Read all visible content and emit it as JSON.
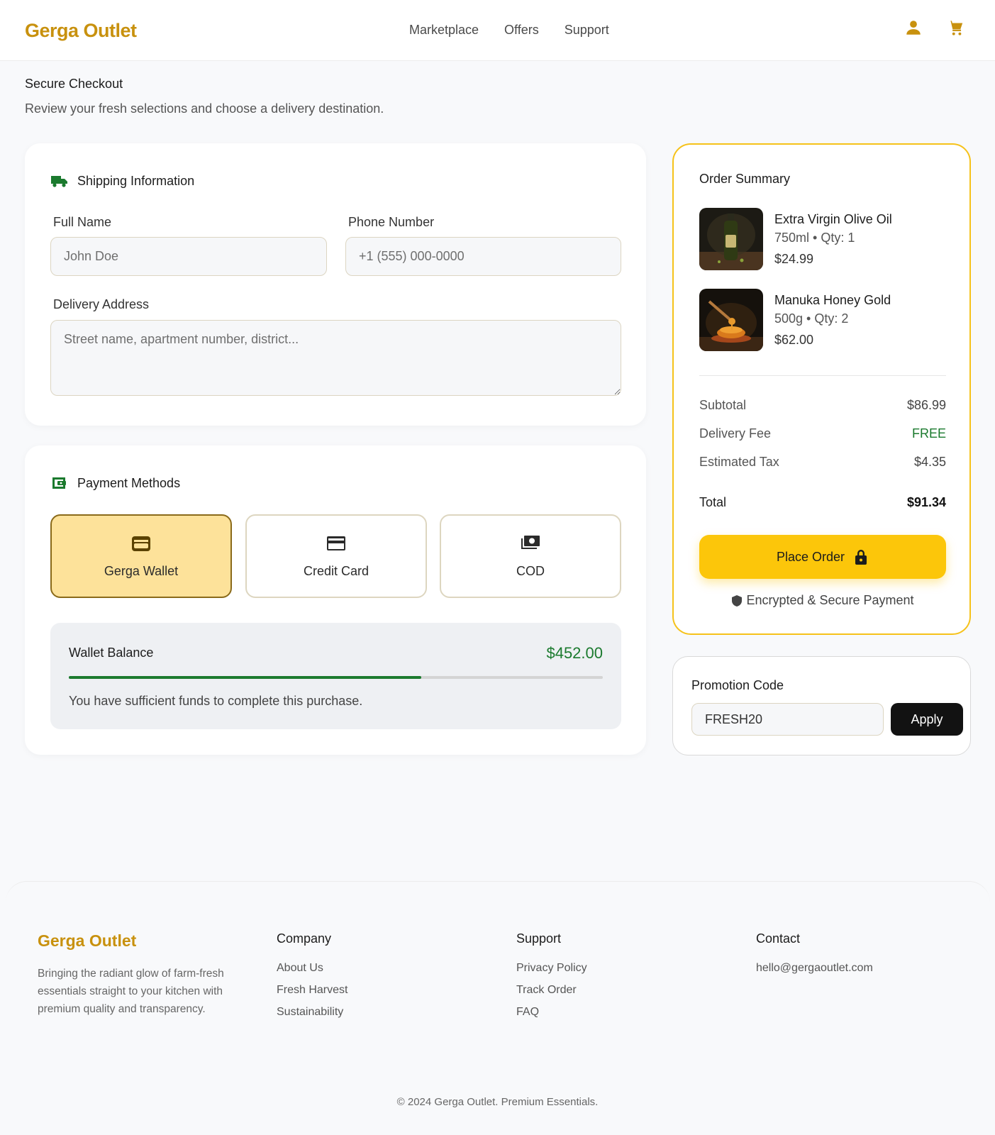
{
  "header": {
    "brand": "Gerga Outlet",
    "nav": [
      "Marketplace",
      "Offers",
      "Support"
    ],
    "icons": [
      "user-icon",
      "cart-icon"
    ],
    "accent_color": "#c8910e"
  },
  "page": {
    "title": "Secure Checkout",
    "subtitle": "Review your fresh selections and choose a delivery destination."
  },
  "shipping": {
    "heading": "Shipping Information",
    "full_name_label": "Full Name",
    "full_name_placeholder": "John Doe",
    "phone_label": "Phone Number",
    "phone_placeholder": "+1 (555) 000-0000",
    "address_label": "Delivery Address",
    "address_placeholder": "Street name, apartment number, district..."
  },
  "payment": {
    "heading": "Payment Methods",
    "options": [
      {
        "label": "Gerga Wallet",
        "icon": "wallet-icon",
        "selected": true
      },
      {
        "label": "Credit Card",
        "icon": "credit-card-icon",
        "selected": false
      },
      {
        "label": "COD",
        "icon": "cash-icon",
        "selected": false
      }
    ],
    "wallet": {
      "title": "Wallet Balance",
      "amount": "$452.00",
      "progress": 0.66,
      "note": "You have sufficient funds to complete this purchase."
    }
  },
  "summary": {
    "title": "Order Summary",
    "items": [
      {
        "name": "Extra Virgin Olive Oil",
        "meta": "750ml • Qty: 1",
        "price": "$24.99"
      },
      {
        "name": "Manuka Honey Gold",
        "meta": "500g • Qty: 2",
        "price": "$62.00"
      }
    ],
    "subtotal_label": "Subtotal",
    "subtotal": "$86.99",
    "delivery_label": "Delivery Fee",
    "delivery": "FREE",
    "tax_label": "Estimated Tax",
    "tax": "$4.35",
    "total_label": "Total",
    "total": "$91.34",
    "place_order": "Place Order",
    "secure_note": "Encrypted & Secure Payment",
    "highlight_color": "#f6c21a"
  },
  "promo": {
    "title": "Promotion Code",
    "value": "FRESH20",
    "apply": "Apply"
  },
  "footer": {
    "brand": "Gerga Outlet",
    "description": "Bringing the radiant glow of farm-fresh essentials straight to your kitchen with premium quality and transparency.",
    "company_title": "Company",
    "company_links": [
      "About Us",
      "Fresh Harvest",
      "Sustainability"
    ],
    "support_title": "Support",
    "support_links": [
      "Privacy Policy",
      "Track Order",
      "FAQ"
    ],
    "contact_title": "Contact",
    "email": "hello@gergaoutlet.com",
    "copyright": "© 2024 Gerga Outlet. Premium Essentials."
  }
}
